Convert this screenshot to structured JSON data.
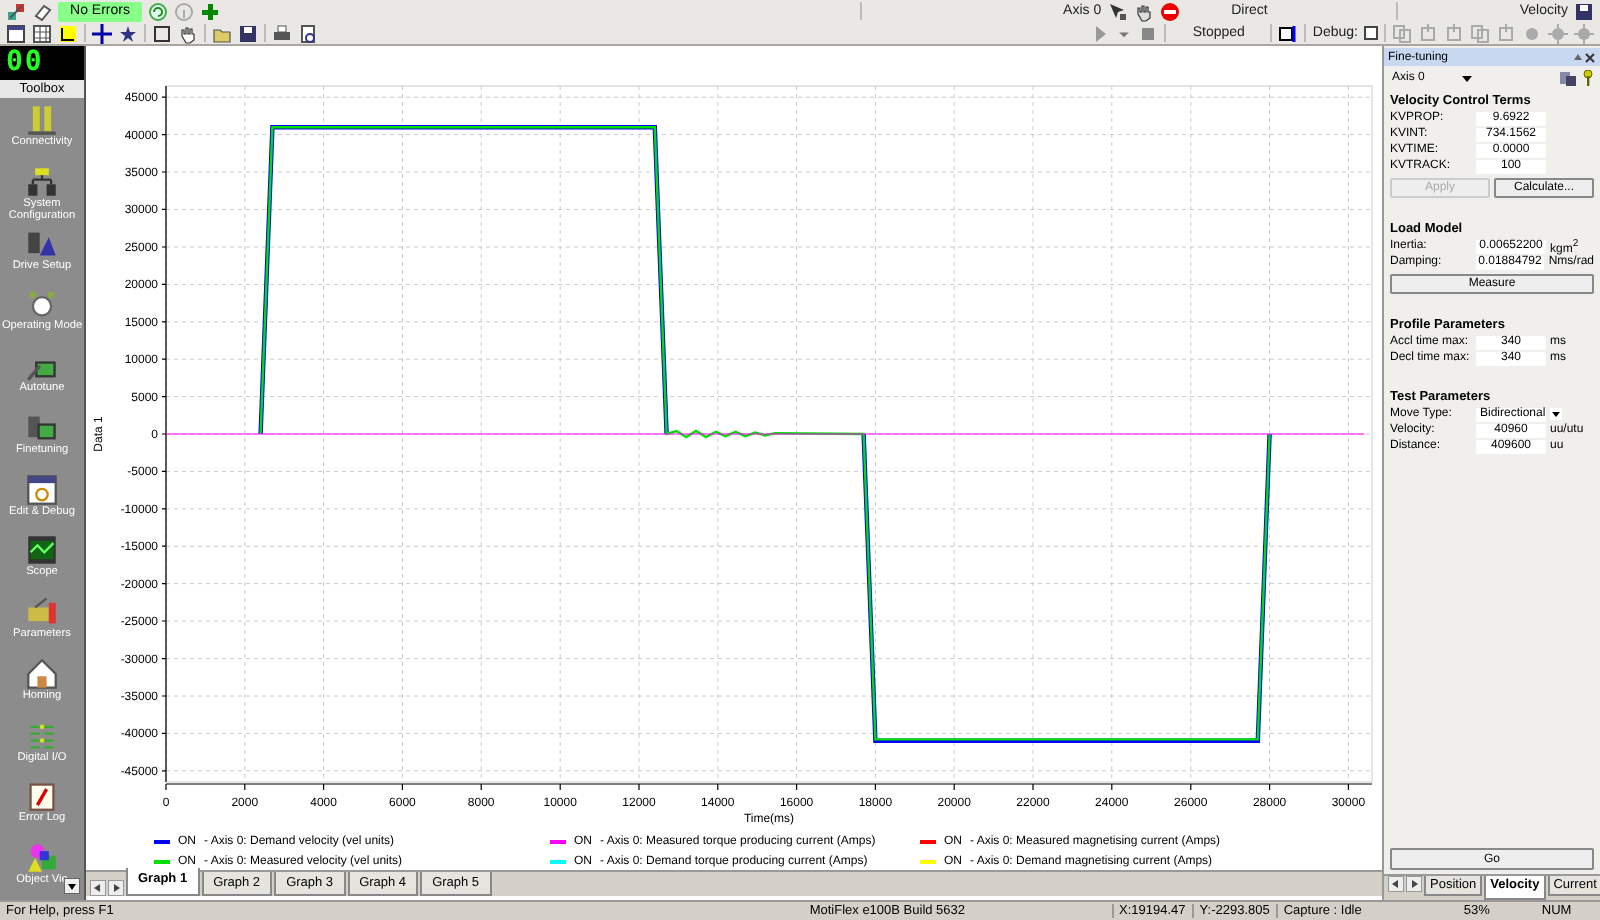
{
  "toolbar": {
    "error_status": "No Errors",
    "axis": "Axis 0",
    "mode": "Direct",
    "control": "Velocity",
    "run_state": "Stopped",
    "debug_label": "Debug:",
    "debug_checked": false
  },
  "toolbox": {
    "display": "00",
    "title": "Toolbox",
    "items": [
      {
        "label": "Connectivity"
      },
      {
        "label": "System Configuration"
      },
      {
        "label": "Drive Setup"
      },
      {
        "label": "Operating Mode"
      },
      {
        "label": "Autotune"
      },
      {
        "label": "Finetuning"
      },
      {
        "label": "Edit & Debug"
      },
      {
        "label": "Scope"
      },
      {
        "label": "Parameters"
      },
      {
        "label": "Homing"
      },
      {
        "label": "Digital I/O"
      },
      {
        "label": "Error Log"
      },
      {
        "label": "Object Vie"
      }
    ]
  },
  "graph": {
    "chart_data": {
      "type": "line",
      "xlabel": "Time(ms)",
      "ylabel": "Data 1",
      "grid": true,
      "x": [
        0,
        2400,
        2700,
        12400,
        12700,
        12950,
        13200,
        13450,
        13700,
        13950,
        14200,
        14450,
        14700,
        14950,
        15200,
        15450,
        17700,
        18000,
        27700,
        28000,
        30400
      ],
      "series": [
        {
          "name": "- Axis 0: Demand velocity (vel units)",
          "color": "#0000ff",
          "values": [
            null,
            0,
            41000,
            41000,
            0,
            null,
            null,
            null,
            null,
            null,
            null,
            null,
            null,
            null,
            null,
            null,
            0,
            -41000,
            -41000,
            0,
            null
          ]
        },
        {
          "name": "- Axis 0: Measured torque producing current (Amps)",
          "color": "#ff00ff",
          "values": [
            0,
            0,
            0,
            0,
            0,
            0,
            0,
            0,
            0,
            0,
            0,
            0,
            0,
            0,
            0,
            0,
            0,
            0,
            0,
            0,
            0
          ]
        },
        {
          "name": "- Axis 0: Measured magnetising current (Amps)",
          "color": "#ff0000",
          "values": [
            null,
            null,
            null,
            null,
            null,
            null,
            null,
            null,
            null,
            null,
            null,
            null,
            null,
            null,
            null,
            null,
            null,
            null,
            null,
            null,
            null
          ]
        },
        {
          "name": "- Axis 0: Measured velocity (vel units)",
          "color": "#00e000",
          "values": [
            null,
            0,
            41000,
            41000,
            0,
            400,
            -400,
            400,
            -400,
            300,
            -300,
            300,
            -300,
            200,
            -200,
            100,
            0,
            -40800,
            -40800,
            0,
            null
          ]
        },
        {
          "name": "- Axis 0: Demand torque producing current (Amps)",
          "color": "#00ffff",
          "values": [
            null,
            null,
            null,
            null,
            null,
            null,
            null,
            null,
            null,
            null,
            null,
            null,
            null,
            null,
            null,
            null,
            null,
            null,
            null,
            null,
            null
          ]
        },
        {
          "name": "- Axis 0: Demand magnetising current (Amps)",
          "color": "#ffff00",
          "values": [
            null,
            null,
            null,
            null,
            null,
            null,
            null,
            null,
            null,
            null,
            null,
            null,
            null,
            null,
            null,
            null,
            null,
            null,
            null,
            null,
            null
          ]
        }
      ],
      "xlim": [
        0,
        30600
      ],
      "ylim": [
        -46500,
        46500
      ],
      "xticks": [
        0,
        2000,
        4000,
        6000,
        8000,
        10000,
        12000,
        14000,
        16000,
        18000,
        20000,
        22000,
        24000,
        26000,
        28000,
        30000
      ],
      "yticks": [
        -45000,
        -40000,
        -35000,
        -30000,
        -25000,
        -20000,
        -15000,
        -10000,
        -5000,
        0,
        5000,
        10000,
        15000,
        20000,
        25000,
        30000,
        35000,
        40000,
        45000
      ]
    },
    "legend": [
      {
        "state": "ON"
      },
      {
        "state": "ON"
      },
      {
        "state": "ON"
      },
      {
        "state": "ON"
      },
      {
        "state": "ON"
      },
      {
        "state": "ON"
      }
    ],
    "tabs": [
      {
        "label": "Graph 1",
        "selected": true
      },
      {
        "label": "Graph 2",
        "selected": false
      },
      {
        "label": "Graph 3",
        "selected": false
      },
      {
        "label": "Graph 4",
        "selected": false
      },
      {
        "label": "Graph 5",
        "selected": false
      }
    ]
  },
  "panel": {
    "title": "Fine-tuning",
    "axis": "Axis 0",
    "velocity_terms": {
      "title": "Velocity Control Terms",
      "rows": [
        {
          "label": "KVPROP:",
          "value": "9.6922"
        },
        {
          "label": "KVINT:",
          "value": "734.1562"
        },
        {
          "label": "KVTIME:",
          "value": "0.0000"
        },
        {
          "label": "KVTRACK:",
          "value": "100"
        }
      ],
      "buttons": [
        {
          "label": "Apply",
          "disabled": true
        },
        {
          "label": "Calculate...",
          "disabled": false
        }
      ]
    },
    "load_model": {
      "title": "Load Model",
      "rows": [
        {
          "label": "Inertia:",
          "value": "0.00652200",
          "unit": "kgm$^{2}$"
        },
        {
          "label": "Damping:",
          "value": "0.01884792",
          "unit": "Nms/rad"
        }
      ],
      "button": "Measure"
    },
    "profile": {
      "title": "Profile Parameters",
      "rows": [
        {
          "label": "Accl time max:",
          "value": "340",
          "unit": "ms"
        },
        {
          "label": "Decl time max:",
          "value": "340",
          "unit": "ms"
        }
      ]
    },
    "test": {
      "title": "Test Parameters",
      "move_type_label": "Move Type:",
      "move_type": "Bidirectional",
      "rows": [
        {
          "label": "Velocity:",
          "value": "40960",
          "unit": "uu/utu"
        },
        {
          "label": "Distance:",
          "value": "409600",
          "unit": "uu"
        }
      ]
    },
    "go": "Go",
    "tabs": [
      {
        "label": "Position",
        "selected": false
      },
      {
        "label": "Velocity",
        "selected": true
      },
      {
        "label": "Current",
        "selected": false
      }
    ]
  },
  "status_bar": {
    "help": "For Help, press F1",
    "build": "MotiFlex e100B Build 5632",
    "x": "X:19194.47",
    "y": "Y:-2293.805",
    "capture": "Capture : Idle",
    "zoom": "53%",
    "num": "NUM"
  }
}
